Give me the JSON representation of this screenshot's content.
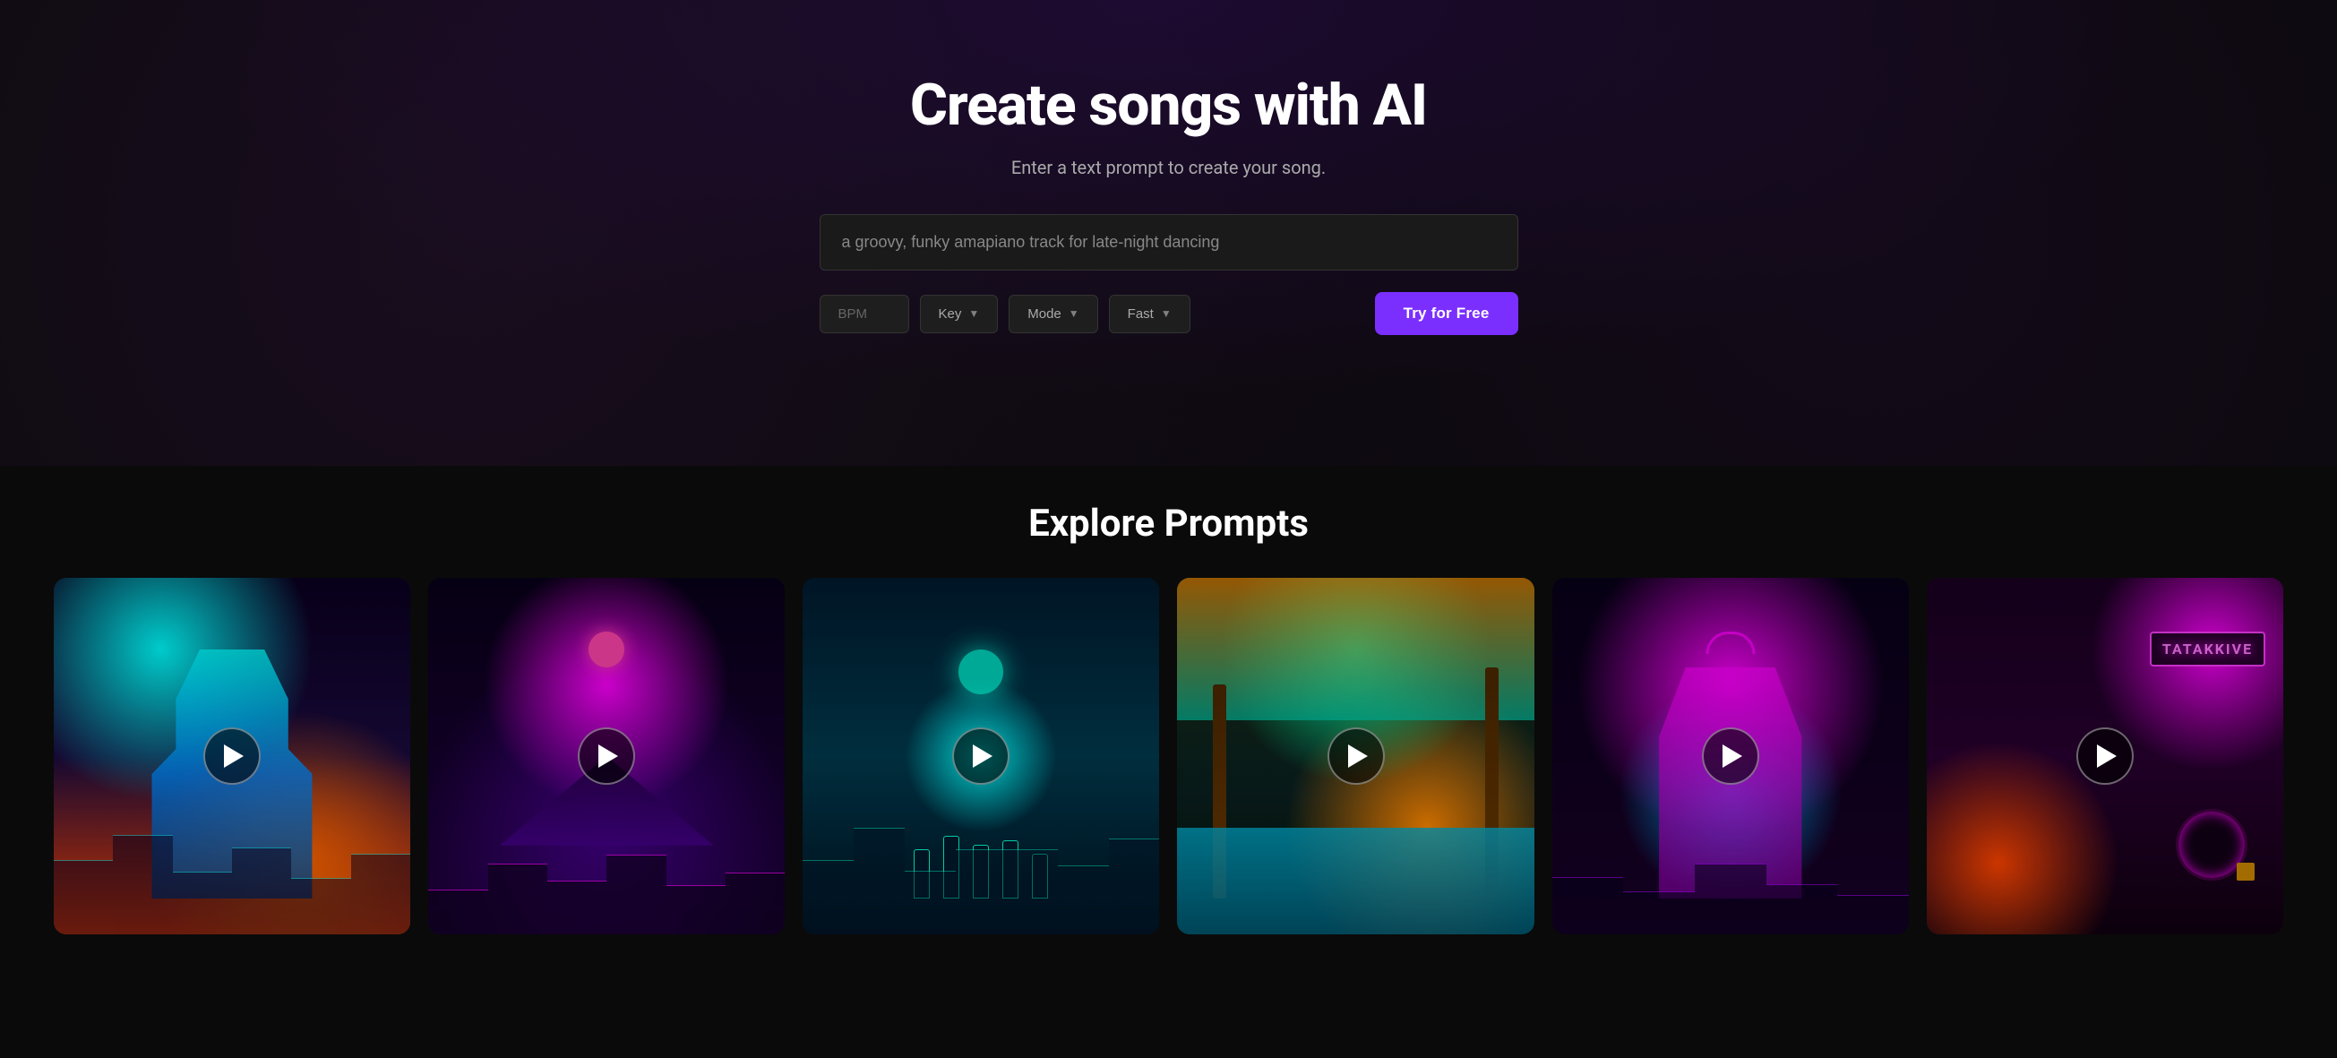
{
  "hero": {
    "title": "Create songs with AI",
    "subtitle": "Enter a text prompt to create your song.",
    "prompt_placeholder": "a groovy, funky amapiano track for late-night dancing",
    "prompt_value": "a groovy, funky amapiano track for late-night dancing",
    "controls": {
      "bpm_placeholder": "BPM",
      "key_label": "Key",
      "mode_label": "Mode",
      "speed_label": "Fast"
    },
    "cta_label": "Try for Free"
  },
  "explore": {
    "title": "Explore Prompts",
    "cards": [
      {
        "id": 1,
        "alt": "Cyberpunk warrior with neon city",
        "theme": "card-1"
      },
      {
        "id": 2,
        "alt": "Synthwave city with pink moon",
        "theme": "card-2"
      },
      {
        "id": 3,
        "alt": "Futuristic band performing on stage",
        "theme": "card-3"
      },
      {
        "id": 4,
        "alt": "Tropical paradise with neon lights",
        "theme": "card-4"
      },
      {
        "id": 5,
        "alt": "DJ in purple neon city",
        "theme": "card-5"
      },
      {
        "id": 6,
        "alt": "Neon sign street scene",
        "theme": "card-6"
      }
    ]
  }
}
